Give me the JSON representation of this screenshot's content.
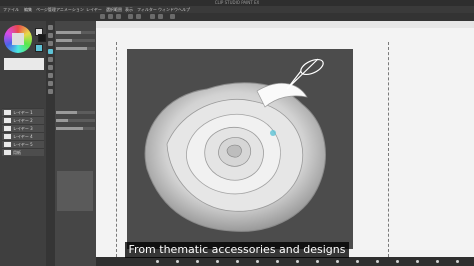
{
  "window": {
    "title": "CLIP STUDIO PAINT EX"
  },
  "menu": [
    {
      "label": "ファイル"
    },
    {
      "label": "編集"
    },
    {
      "label": "ページ管理"
    },
    {
      "label": "アニメーション"
    },
    {
      "label": "レイヤー"
    },
    {
      "label": "選択範囲"
    },
    {
      "label": "表示"
    },
    {
      "label": "フィルター"
    },
    {
      "label": "ウィンドウ"
    },
    {
      "label": "ヘルプ"
    }
  ],
  "layers": [
    {
      "name": "レイヤー 1"
    },
    {
      "name": "レイヤー 2"
    },
    {
      "name": "レイヤー 3"
    },
    {
      "name": "レイヤー 4"
    },
    {
      "name": "レイヤー 5"
    },
    {
      "name": "用紙"
    }
  ],
  "canvas": {
    "subject": "rose illustration",
    "background": "#4c4c4c"
  },
  "caption": {
    "text": "From thematic accessories and designs"
  },
  "colors": {
    "accent": "#5ec3d6",
    "canvas_bg": "#f3f3f3",
    "panel_bg": "#3f3f3f"
  },
  "tool_properties": {
    "levels": [
      0.65,
      0.4,
      0.8,
      0.55,
      0.3,
      0.7
    ]
  }
}
